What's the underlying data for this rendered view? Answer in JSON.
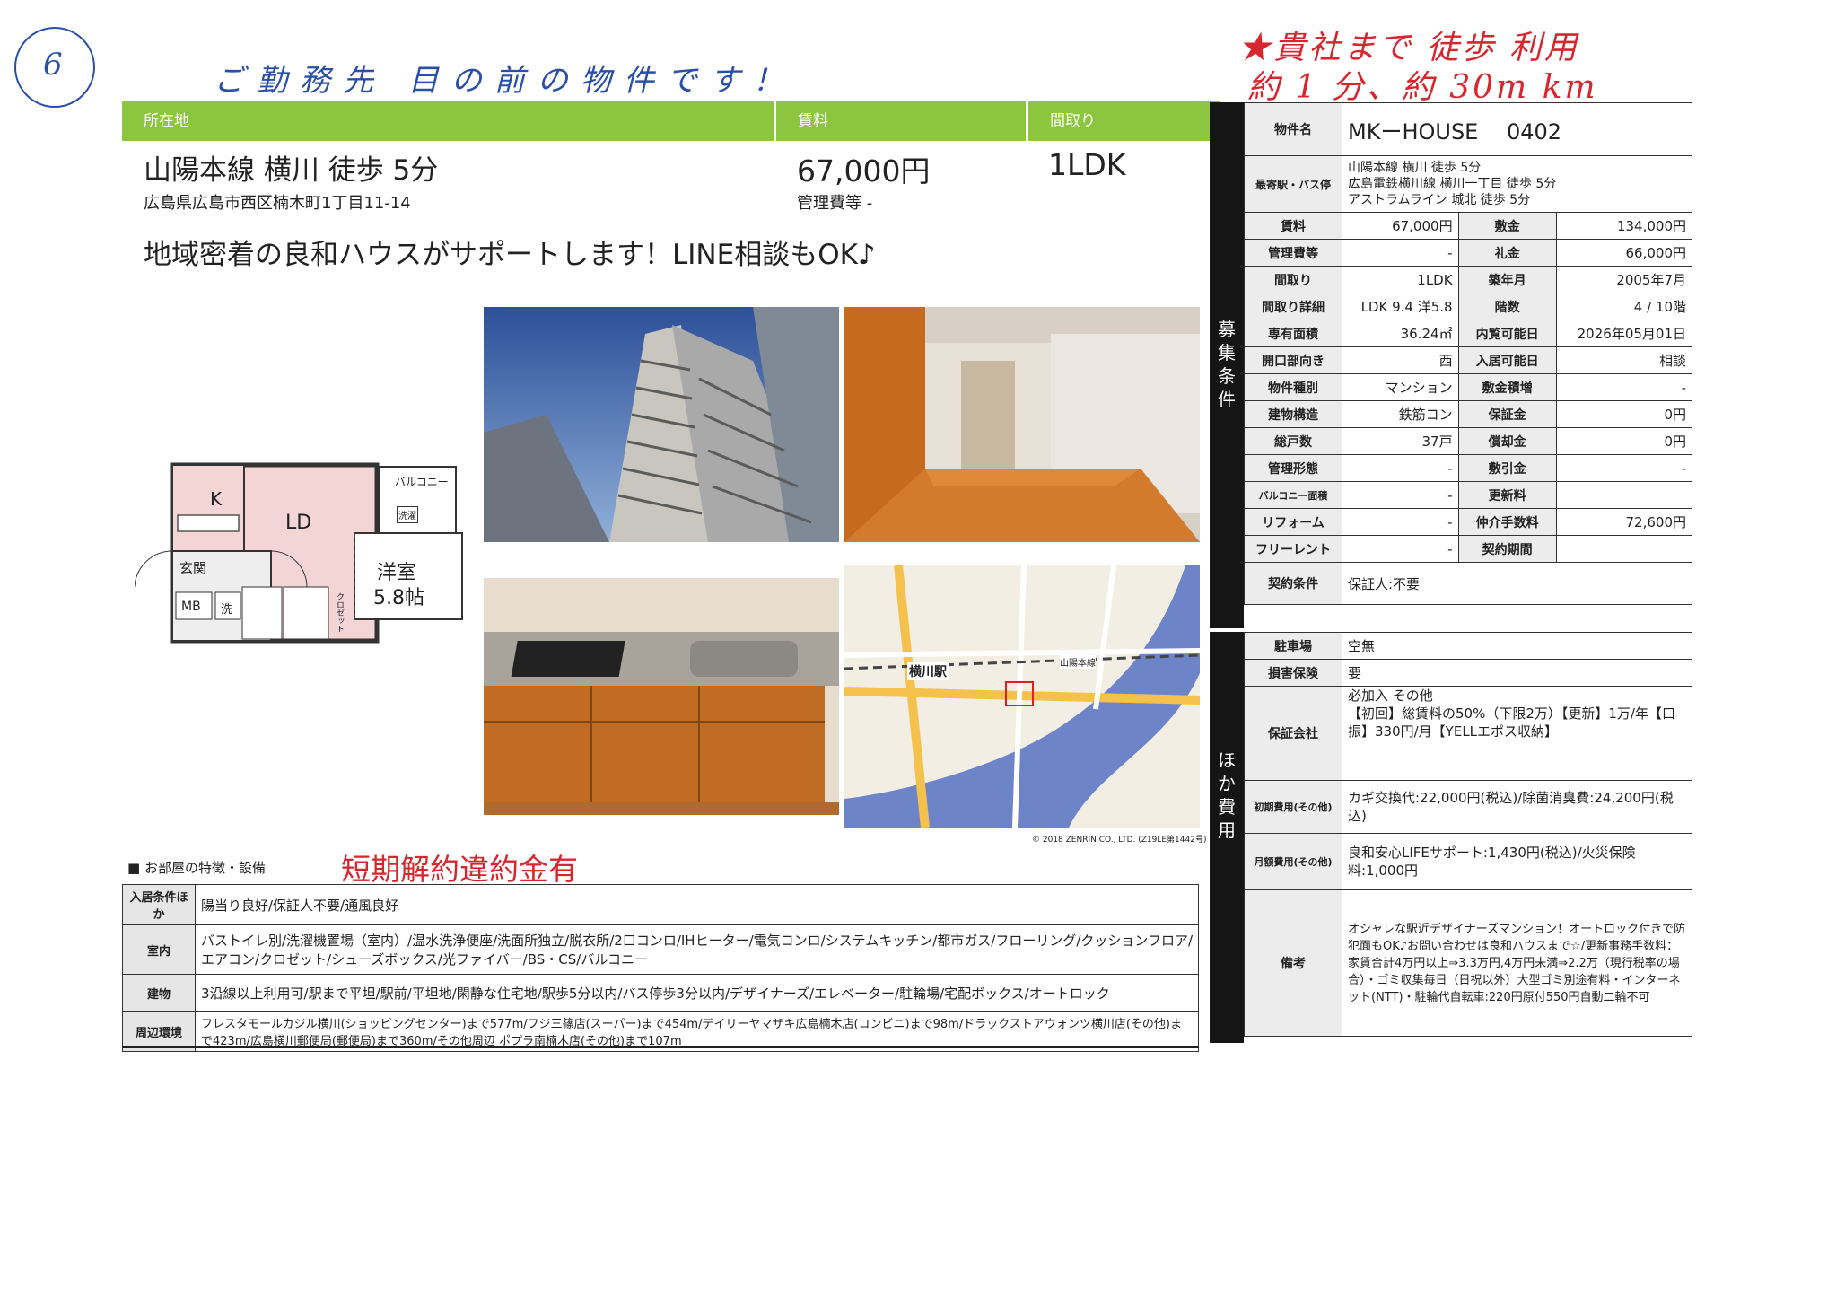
{
  "annotations": {
    "circle_number": "6",
    "blue_note": "ご勤務先 目の前の物件です！",
    "red_line1": "★貴社まで 徒歩 利用",
    "red_line2": "約 1 分、約 30m km",
    "short_term_penalty": "短期解約違約金有"
  },
  "header_bars": {
    "location_label": "所在地",
    "rent_label": "賃料",
    "layout_label": "間取り"
  },
  "summary": {
    "station": "山陽本線 横川 徒歩 5分",
    "address": "広島県広島市西区楠木町1丁目11-14",
    "rent": "67,000円",
    "mgmt_fee": "管理費等 -",
    "layout": "1LDK",
    "catchphrase": "地域密着の良和ハウスがサポートします！LINE相談もOK♪"
  },
  "floorplan": {
    "k": "K",
    "ld": "LD",
    "balcony": "バルコニー",
    "washer": "洗濯",
    "entrance": "玄関",
    "mb": "MB",
    "wash": "洗",
    "room": "洋室",
    "room_size": "5.8帖",
    "closet": "クロゼット"
  },
  "map": {
    "station_label": "横川駅",
    "line_label": "山陽本線",
    "copyright": "© 2018 ZENRIN CO., LTD. (Z19LE第1442号)"
  },
  "property": {
    "name_label": "物件名",
    "name": "MKーHOUSE　 0402",
    "station_label": "最寄駅・バス停",
    "stations": [
      "山陽本線 横川 徒歩 5分",
      "広島電鉄横川線 横川一丁目 徒歩 5分",
      "アストラムライン 城北 徒歩 5分"
    ],
    "section_title": [
      "募",
      "集",
      "条",
      "件"
    ],
    "rows": [
      {
        "l1": "賃料",
        "v1": "67,000円",
        "l2": "敷金",
        "v2": "134,000円"
      },
      {
        "l1": "管理費等",
        "v1": "-",
        "l2": "礼金",
        "v2": "66,000円"
      },
      {
        "l1": "間取り",
        "v1": "1LDK",
        "l2": "築年月",
        "v2": "2005年7月"
      },
      {
        "l1": "間取り詳細",
        "v1": "LDK 9.4 洋5.8",
        "l2": "階数",
        "v2": "4 / 10階"
      },
      {
        "l1": "専有面積",
        "v1": "36.24㎡",
        "l2": "内覧可能日",
        "v2": "2026年05月01日"
      },
      {
        "l1": "開口部向き",
        "v1": "西",
        "l2": "入居可能日",
        "v2": "相談"
      },
      {
        "l1": "物件種別",
        "v1": "マンション",
        "l2": "敷金積増",
        "v2": "-"
      },
      {
        "l1": "建物構造",
        "v1": "鉄筋コン",
        "l2": "保証金",
        "v2": "0円"
      },
      {
        "l1": "総戸数",
        "v1": "37戸",
        "l2": "償却金",
        "v2": "0円"
      },
      {
        "l1": "管理形態",
        "v1": "-",
        "l2": "敷引金",
        "v2": "-"
      },
      {
        "l1": "バルコニー面積",
        "v1": "-",
        "l2": "更新料",
        "v2": ""
      },
      {
        "l1": "リフォーム",
        "v1": "-",
        "l2": "仲介手数料",
        "v2": "72,600円"
      },
      {
        "l1": "フリーレント",
        "v1": "-",
        "l2": "契約期間",
        "v2": ""
      }
    ],
    "contract_label": "契約条件",
    "contract": "保証人:不要"
  },
  "other_costs": {
    "section_title": [
      "ほ",
      "か",
      "費",
      "用"
    ],
    "parking_label": "駐車場",
    "parking": "空無",
    "insurance_label": "損害保険",
    "insurance": "要",
    "guarantor_label": "保証会社",
    "guarantor": "必加入 その他\n【初回】総賃料の50%（下限2万）【更新】1万/年【口振】330円/月【YELLエポス収納】",
    "initial_label": "初期費用(その他)",
    "initial": "カギ交換代:22,000円(税込)/除菌消臭費:24,200円(税込)",
    "monthly_label": "月額費用(その他)",
    "monthly": "良和安心LIFEサポート:1,430円(税込)/火災保険料:1,000円",
    "remarks_label": "備考",
    "remarks": "オシャレな駅近デザイナーズマンション！オートロック付きで防犯面もOK♪お問い合わせは良和ハウスまで☆/更新事務手数料：家賃合計4万円以上⇒3.3万円,4万円未満⇒2.2万（現行税率の場合）・ゴミ収集毎日（日祝以外）大型ゴミ別途有料・インターネット(NTT)・駐輪代自転車:220円原付550円自動二輪不可"
  },
  "features": {
    "heading": "■ お部屋の特徴・設備",
    "rows": [
      {
        "label": "入居条件ほか",
        "text": "陽当り良好/保証人不要/通風良好"
      },
      {
        "label": "室内",
        "text": "バストイレ別/洗濯機置場（室内）/温水洗浄便座/洗面所独立/脱衣所/2口コンロ/IHヒーター/電気コンロ/システムキッチン/都市ガス/フローリング/クッションフロア/エアコン/クロゼット/シューズボックス/光ファイバー/BS・CS/バルコニー"
      },
      {
        "label": "建物",
        "text": "3沿線以上利用可/駅まで平坦/駅前/平坦地/閑静な住宅地/駅歩5分以内/バス停歩3分以内/デザイナーズ/エレベーター/駐輪場/宅配ボックス/オートロック"
      },
      {
        "label": "周辺環境",
        "text": "フレスタモールカジル横川(ショッピングセンター)まで577m/フジ三篠店(スーパー)まで454m/デイリーヤマザキ広島楠木店(コンビニ)まで98m/ドラックストアウォンツ横川店(その他)まで423m/広島横川郵便局(郵便局)まで360m/その他周辺 ポプラ南楠木店(その他)まで107m"
      }
    ]
  },
  "colors": {
    "accent_green": "#8cc63f",
    "dark_header": "#151515",
    "handwriting_red": "#d8262e",
    "handwriting_blue": "#2a4fa8"
  }
}
